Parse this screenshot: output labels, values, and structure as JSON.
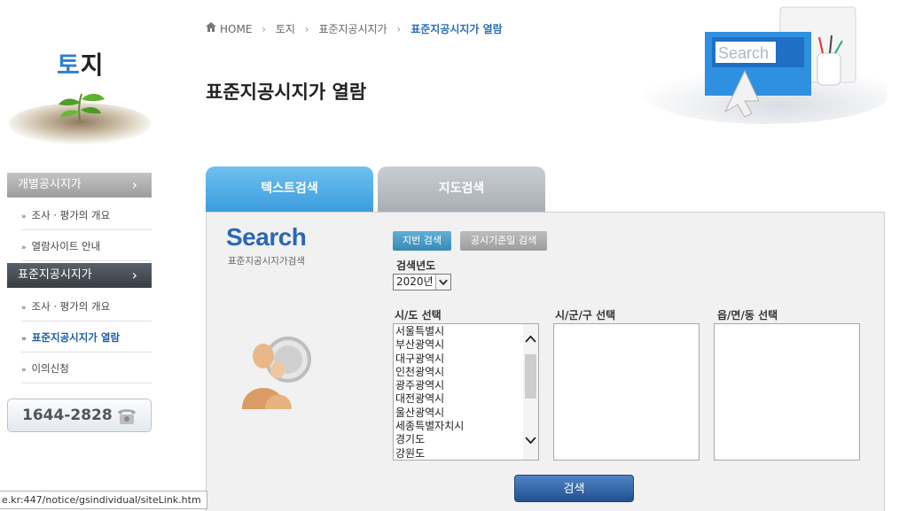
{
  "sidebar": {
    "title_part1": "토",
    "title_part2": "지",
    "group1_label": "개별공시지가",
    "group1_chevron": "›",
    "group1_items": [
      "조사 · 평가의 개요",
      "열람사이트 안내"
    ],
    "group2_label": "표준지공시지가",
    "group2_chevron": "›",
    "group2_items": [
      "조사 · 평가의 개요",
      "표준지공시지가 열람",
      "이의신청"
    ],
    "bullet": "»",
    "phone": "1644-2828"
  },
  "breadcrumb": {
    "home": "HOME",
    "sep": "›",
    "level1": "토지",
    "level2": "표준지공시지가",
    "current": "표준지공시지가 열람"
  },
  "page_title": "표준지공시지가 열람",
  "decoration_text": "Search",
  "tabs": [
    "텍스트검색",
    "지도검색"
  ],
  "panel": {
    "logo": "Search",
    "subtitle": "표준지공시지가검색",
    "btn_lot": "지번 검색",
    "btn_date": "공시기준일 검색",
    "year_label": "검색년도",
    "year_value": "2020년",
    "sido_label": "시/도 선택",
    "sigungu_label": "시/군/구 선택",
    "eupmyeon_label": "읍/면/동 선택",
    "sido_options": [
      "서울특별시",
      "부산광역시",
      "대구광역시",
      "인천광역시",
      "광주광역시",
      "대전광역시",
      "울산광역시",
      "세종특별자치시",
      "경기도",
      "강원도"
    ],
    "search_button": "검색"
  },
  "status_url": "e.kr:447/notice/gsindividual/siteLink.htm",
  "colors": {
    "accent": "#2f7fd0",
    "tab_active": "#4aa8e3",
    "tab_inactive": "#b5b9bf",
    "button": "#2d5f9f"
  }
}
